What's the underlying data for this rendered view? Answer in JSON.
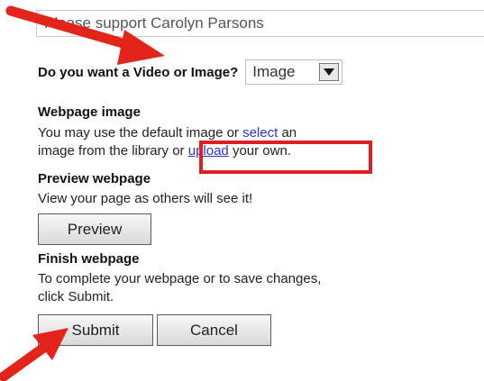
{
  "title_field": {
    "value": "Please support Carolyn Parsons"
  },
  "media": {
    "label": "Do you want a Video or Image?",
    "selected": "Image",
    "dropdown_icon": "triangle-down-icon"
  },
  "webpage_image": {
    "heading": "Webpage image",
    "line1_pre": "You may use the default image or ",
    "select_link": "select",
    "line1_post": " an",
    "line2_pre": "image from the library or ",
    "upload_link": "upload",
    "line2_post": " your own."
  },
  "preview": {
    "heading": "Preview webpage",
    "text": "View your page as others will see it!",
    "button": "Preview"
  },
  "finish": {
    "heading": "Finish webpage",
    "text_line1": "To complete your webpage or to save changes,",
    "text_line2": "click Submit.",
    "submit_button": "Submit",
    "cancel_button": "Cancel"
  },
  "annotations": {
    "arrow_color": "#e3241b",
    "highlight_color": "#dd1f1f"
  }
}
